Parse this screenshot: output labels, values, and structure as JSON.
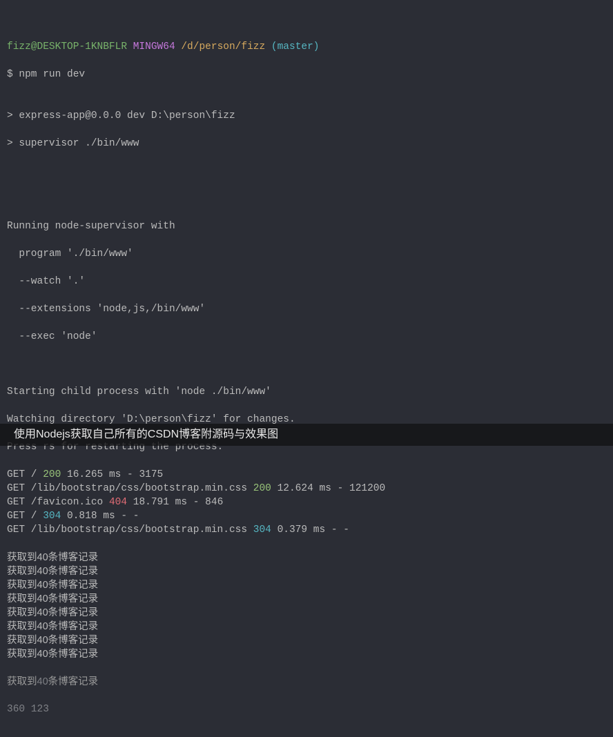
{
  "prompt": {
    "user_host": "fizz@DESKTOP-1KNBFLR",
    "mingw": "MINGW64",
    "path": "/d/person/fizz",
    "branch": "(master)"
  },
  "commands": {
    "npm": "$ npm run dev",
    "blank1": "",
    "script1": "> express-app@0.0.0 dev D:\\person\\fizz",
    "script2": "> supervisor ./bin/www"
  },
  "supervisor": {
    "header": "Running node-supervisor with",
    "program": "  program './bin/www'",
    "watch": "  --watch '.'",
    "extensions": "  --extensions 'node,js,/bin/www'",
    "exec": "  --exec 'node'",
    "starting": "Starting child process with 'node ./bin/www'",
    "watching": "Watching directory 'D:\\person\\fizz' for changes.",
    "press": "Press rs for restarting the process."
  },
  "requests": [
    {
      "pre": "GET / ",
      "status": "200",
      "cls": "status200",
      "post": " 16.265 ms - 3175"
    },
    {
      "pre": "GET /lib/bootstrap/css/bootstrap.min.css ",
      "status": "200",
      "cls": "status200",
      "post": " 12.624 ms - 121200"
    },
    {
      "pre": "GET /favicon.ico ",
      "status": "404",
      "cls": "status404",
      "post": " 18.791 ms - 846"
    },
    {
      "pre": "GET / ",
      "status": "304",
      "cls": "status304",
      "post": " 0.818 ms - -"
    },
    {
      "pre": "GET /lib/bootstrap/css/bootstrap.min.css ",
      "status": "304",
      "cls": "status304",
      "post": " 0.379 ms - -"
    }
  ],
  "logs": {
    "line": "获取到40条博客记录",
    "count": 8
  },
  "tail": {
    "pre": "获取到",
    "num": "40",
    "c1": "条",
    "c2": "博",
    "rest": "客记录"
  },
  "footer": "360 123",
  "caption": "使用Nodejs获取自己所有的CSDN博客附源码与效果图"
}
